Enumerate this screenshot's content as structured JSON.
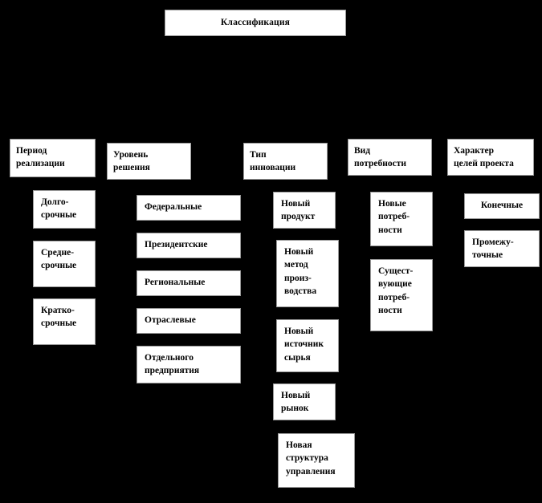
{
  "diagram": {
    "type": "hierarchy-tree",
    "background_color": "#000000",
    "node_fill_color": "#ffffff",
    "node_text_color": "#000000",
    "node_border_color": "#9a9a9a",
    "root": {
      "label": "Классификация"
    },
    "columns": [
      {
        "header": "Период\nреализации",
        "items": [
          "Долго-\nсрочные",
          "Средне-\nсрочные",
          "Кратко-\nсрочные"
        ]
      },
      {
        "header": "Уровень\nрешения",
        "items": [
          "Федеральные",
          "Президентские",
          "Региональные",
          "Отраслевые",
          "Отдельного\nпредприятия"
        ]
      },
      {
        "header": "Тип\nинновации",
        "items": [
          "Новый\nпродукт",
          "Новый\nметод\nпроиз-\nводства",
          "Новый\nисточник\nсырья",
          "Новый\nрынок",
          "Новая\nструктура\nуправления"
        ]
      },
      {
        "header": "Вид\nпотребности",
        "items": [
          "Новые\nпотреб-\nности",
          "Сущест-\nвующие\nпотреб-\nности"
        ]
      },
      {
        "header": "Характер\nцелей проекта",
        "items": [
          "Конечные",
          "Промежу-\nточные"
        ]
      }
    ]
  }
}
